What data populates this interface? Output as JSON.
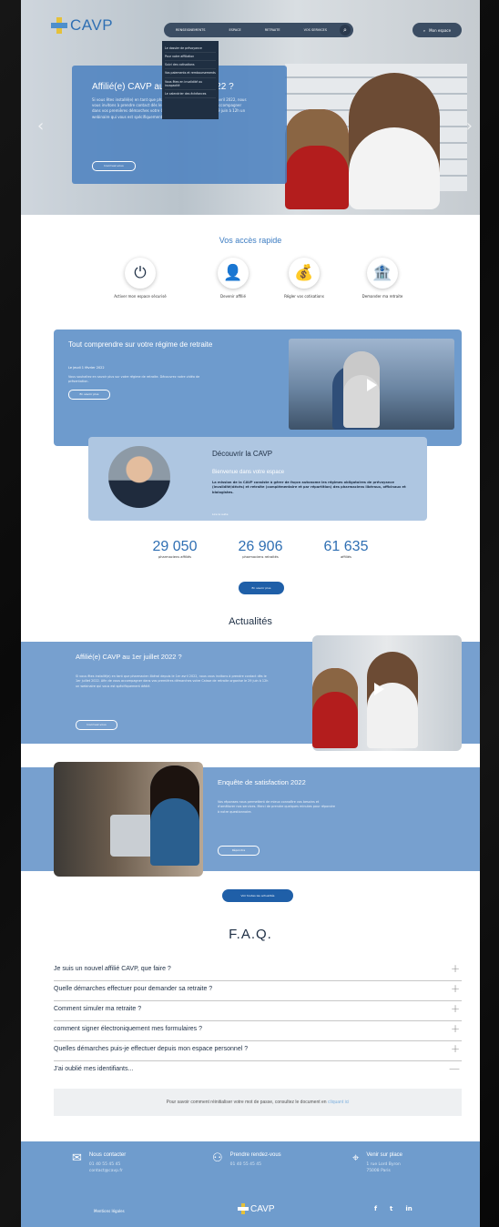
{
  "header": {
    "logo_text": "CAVP",
    "nav": [
      "Renseignements",
      "Espace",
      "Retraite",
      "Vos services"
    ],
    "espace_label": "Mon espace"
  },
  "dropdown": {
    "items": [
      "Le dossier de prévoyance",
      "Pour votre affiliation",
      "Suivi des cotisations",
      "Vos paiements et remboursements",
      "Vous êtes en invalidité ou incapacité",
      "Le calendrier des échéances"
    ]
  },
  "hero": {
    "title": "Affilié(e) CAVP au 1er juillet 2022 ?",
    "text": "Si vous êtes installé(e) en tant que pharmacien libéral depuis le 1er avril 2022, nous vous invitons à prendre contact dès le 1er juillet 2022. Afin de vous accompagner dans vos premières démarches votre Caisse de retraite organise le 29 juin à 12h un webinaire qui vous est spécifiquement dédié.",
    "button": "Inscrivez-vous"
  },
  "quick_access": {
    "title": "Vos accès rapide",
    "items": [
      {
        "icon": "power-icon",
        "glyph": "⏻",
        "label": "Activer mon espace sécurisé"
      },
      {
        "icon": "user-add-icon",
        "glyph": "👤",
        "label": "Devenir affilié"
      },
      {
        "icon": "money-bag-icon",
        "glyph": "💰",
        "label": "Régler vos cotisations"
      },
      {
        "icon": "retirement-icon",
        "glyph": "🏦",
        "label": "Demander ma retraite"
      }
    ]
  },
  "regime": {
    "title": "Tout comprendre sur votre régime de retraite",
    "date": "Le jeudi 1 février 2022",
    "text": "Vous souhaitez en savoir plus sur votre régime de retraite. Découvrez notre vidéo de présentation.",
    "button": "En savoir plus"
  },
  "decouvrir": {
    "title": "Découvrir la CAVP",
    "subtitle": "Bienvenue dans votre espace",
    "text": "La mission de la CAVP consiste à gérer de façon autonome les régimes obligatoires de prévoyance (invalidité/décès) et retraite (complémentaire et par répartition) des pharmaciens libéraux, officinaux et biologistes.",
    "more": "Lire la suite"
  },
  "stats": [
    {
      "value": "29 050",
      "label": "pharmaciens affiliés"
    },
    {
      "value": "26 906",
      "label": "pharmaciens retraités"
    },
    {
      "value": "61 635",
      "label": "affiliés"
    }
  ],
  "stats_button": "En savoir plus",
  "news": {
    "title": "Actualités",
    "items": [
      {
        "title": "Affilié(e) CAVP au 1er juillet 2022 ?",
        "text": "Si vous êtes installé(e) en tant que pharmacien libéral depuis le 1er avril 2022, nous vous invitons à prendre contact dès le 1er juillet 2022. Afin de vous accompagner dans vos premières démarches votre Caisse de retraite organise le 29 juin à 12h un webinaire qui vous est spécifiquement dédié.",
        "button": "Inscrivez-vous"
      },
      {
        "title": "Enquête de satisfaction 2022",
        "text": "Vos réponses nous permettent de mieux connaître vos besoins et d'améliorer nos services. Merci de prendre quelques minutes pour répondre à notre questionnaire.",
        "button": "Répondre"
      }
    ],
    "all_button": "Voir toutes les actualités"
  },
  "faq": {
    "title": "F.A.Q.",
    "items": [
      {
        "q": "Je suis un nouvel affilié CAVP, que faire ?",
        "icon": "+"
      },
      {
        "q": "Quelle démarches effectuer pour demander sa retraite ?",
        "icon": "+"
      },
      {
        "q": "Comment simuler ma retraite ?",
        "icon": "+"
      },
      {
        "q": "comment signer électroniquement mes formulaires ?",
        "icon": "+"
      },
      {
        "q": "Quelles démarches puis-je effectuer depuis mon espace personnel ?",
        "icon": "+"
      },
      {
        "q": "J'ai oublié mes identifiants...",
        "icon": "—"
      }
    ],
    "answer": "Pour savoir comment réinitialiser votre mot de passe, consultez le document en",
    "answer_link": "cliquant ici"
  },
  "footer": {
    "contact": {
      "title": "Nous contacter",
      "line1": "01 40 55 45 45",
      "line2": "contact@cavp.fr"
    },
    "rdv": {
      "title": "Prendre rendez-vous",
      "line1": "01 40 55 45 45"
    },
    "visit": {
      "title": "Venir sur place",
      "line1": "1 rue Lord Byron",
      "line2": "75008 Paris"
    },
    "legal": "Mentions légales",
    "logo_text": "CAVP",
    "social": [
      "f",
      "t",
      "in"
    ]
  }
}
